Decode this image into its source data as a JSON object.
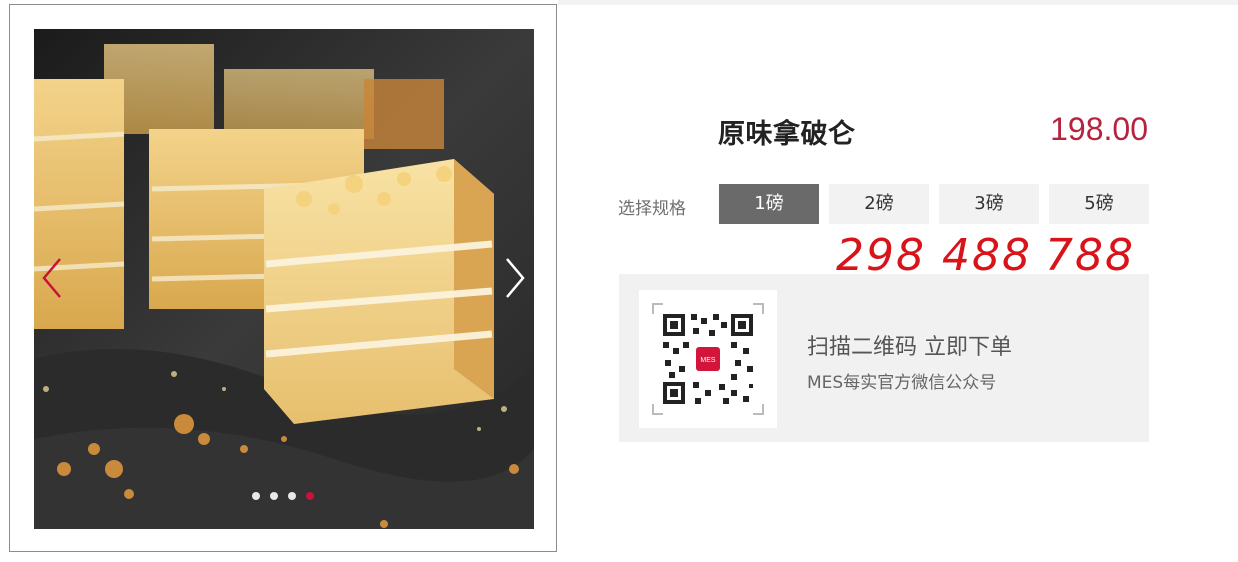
{
  "gallery": {
    "image_label": "原味拿破仑 photo",
    "prev_icon": "chevron-left-icon",
    "next_icon": "chevron-right-icon",
    "slide_count": 4,
    "active_slide": 4
  },
  "product": {
    "title": "原味拿破仑",
    "price": "198.00"
  },
  "spec": {
    "label": "选择规格",
    "options": [
      "1磅",
      "2磅",
      "3磅",
      "5磅"
    ],
    "selected": "1磅"
  },
  "annotation": {
    "prices": [
      "298",
      "488",
      "788"
    ]
  },
  "qr": {
    "logo_text": "MES",
    "title": "扫描二维码 立即下单",
    "subtitle": "MES每实官方微信公众号"
  },
  "colors": {
    "price": "#b5233e",
    "accent": "#c8123a",
    "selected_bg": "#6a6a6a",
    "annotation": "#d8141a"
  }
}
